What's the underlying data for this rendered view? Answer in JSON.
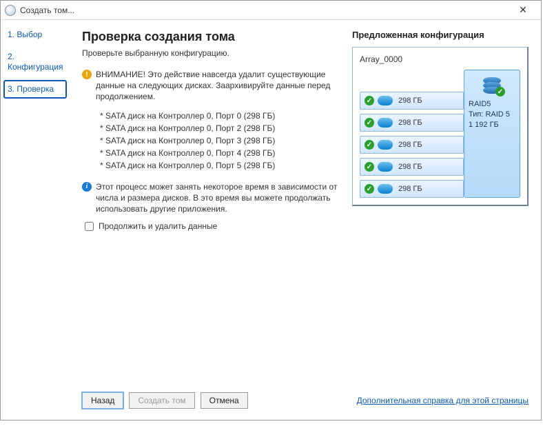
{
  "titlebar": {
    "title": "Создать том..."
  },
  "sidebar": {
    "steps": [
      {
        "label": "1. Выбор"
      },
      {
        "label": "2. Конфигурация"
      },
      {
        "label": "3. Проверка"
      }
    ]
  },
  "main": {
    "heading": "Проверка создания тома",
    "subhead": "Проверьте выбранную конфигурацию.",
    "warn_text": "ВНИМАНИЕ! Это действие навсегда удалит существующие данные на следующих дисках. Заархивируйте данные перед продолжением.",
    "disks": [
      "* SATA диск на Контроллер 0, Порт 0 (298 ГБ)",
      "* SATA диск на Контроллер 0, Порт 2 (298 ГБ)",
      "* SATA диск на Контроллер 0, Порт 3 (298 ГБ)",
      "* SATA диск на Контроллер 0, Порт 4 (298 ГБ)",
      "* SATA диск на Контроллер 0, Порт 5 (298 ГБ)"
    ],
    "info_text": "Этот процесс может занять некоторое время в зависимости от числа и размера дисков. В это время вы можете продолжать использовать другие приложения.",
    "checkbox_label": "Продолжить и удалить данные"
  },
  "config": {
    "header": "Предложенная конфигурация",
    "array_name": "Array_0000",
    "drives": [
      {
        "size": "298 ГБ"
      },
      {
        "size": "298 ГБ"
      },
      {
        "size": "298 ГБ"
      },
      {
        "size": "298 ГБ"
      },
      {
        "size": "298 ГБ"
      }
    ],
    "volume": {
      "name": "RAID5",
      "type_label": "Тип: RAID 5",
      "capacity": "1 192 ГБ"
    }
  },
  "footer": {
    "back": "Назад",
    "create": "Создать том",
    "cancel": "Отмена",
    "help": "Дополнительная справка для этой страницы"
  }
}
